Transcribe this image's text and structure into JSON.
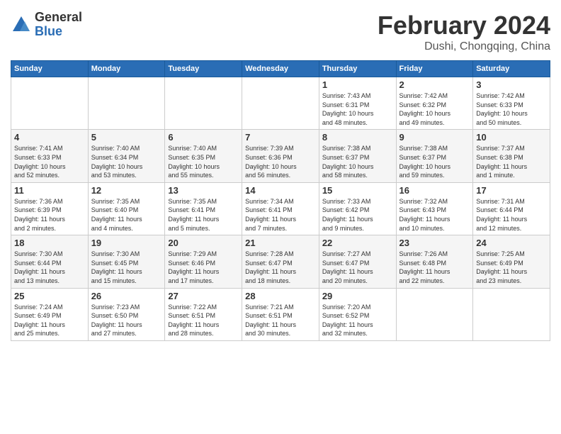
{
  "logo": {
    "general": "General",
    "blue": "Blue"
  },
  "title": "February 2024",
  "location": "Dushi, Chongqing, China",
  "headers": [
    "Sunday",
    "Monday",
    "Tuesday",
    "Wednesday",
    "Thursday",
    "Friday",
    "Saturday"
  ],
  "weeks": [
    [
      {
        "day": "",
        "info": ""
      },
      {
        "day": "",
        "info": ""
      },
      {
        "day": "",
        "info": ""
      },
      {
        "day": "",
        "info": ""
      },
      {
        "day": "1",
        "info": "Sunrise: 7:43 AM\nSunset: 6:31 PM\nDaylight: 10 hours\nand 48 minutes."
      },
      {
        "day": "2",
        "info": "Sunrise: 7:42 AM\nSunset: 6:32 PM\nDaylight: 10 hours\nand 49 minutes."
      },
      {
        "day": "3",
        "info": "Sunrise: 7:42 AM\nSunset: 6:33 PM\nDaylight: 10 hours\nand 50 minutes."
      }
    ],
    [
      {
        "day": "4",
        "info": "Sunrise: 7:41 AM\nSunset: 6:33 PM\nDaylight: 10 hours\nand 52 minutes."
      },
      {
        "day": "5",
        "info": "Sunrise: 7:40 AM\nSunset: 6:34 PM\nDaylight: 10 hours\nand 53 minutes."
      },
      {
        "day": "6",
        "info": "Sunrise: 7:40 AM\nSunset: 6:35 PM\nDaylight: 10 hours\nand 55 minutes."
      },
      {
        "day": "7",
        "info": "Sunrise: 7:39 AM\nSunset: 6:36 PM\nDaylight: 10 hours\nand 56 minutes."
      },
      {
        "day": "8",
        "info": "Sunrise: 7:38 AM\nSunset: 6:37 PM\nDaylight: 10 hours\nand 58 minutes."
      },
      {
        "day": "9",
        "info": "Sunrise: 7:38 AM\nSunset: 6:37 PM\nDaylight: 10 hours\nand 59 minutes."
      },
      {
        "day": "10",
        "info": "Sunrise: 7:37 AM\nSunset: 6:38 PM\nDaylight: 11 hours\nand 1 minute."
      }
    ],
    [
      {
        "day": "11",
        "info": "Sunrise: 7:36 AM\nSunset: 6:39 PM\nDaylight: 11 hours\nand 2 minutes."
      },
      {
        "day": "12",
        "info": "Sunrise: 7:35 AM\nSunset: 6:40 PM\nDaylight: 11 hours\nand 4 minutes."
      },
      {
        "day": "13",
        "info": "Sunrise: 7:35 AM\nSunset: 6:41 PM\nDaylight: 11 hours\nand 5 minutes."
      },
      {
        "day": "14",
        "info": "Sunrise: 7:34 AM\nSunset: 6:41 PM\nDaylight: 11 hours\nand 7 minutes."
      },
      {
        "day": "15",
        "info": "Sunrise: 7:33 AM\nSunset: 6:42 PM\nDaylight: 11 hours\nand 9 minutes."
      },
      {
        "day": "16",
        "info": "Sunrise: 7:32 AM\nSunset: 6:43 PM\nDaylight: 11 hours\nand 10 minutes."
      },
      {
        "day": "17",
        "info": "Sunrise: 7:31 AM\nSunset: 6:44 PM\nDaylight: 11 hours\nand 12 minutes."
      }
    ],
    [
      {
        "day": "18",
        "info": "Sunrise: 7:30 AM\nSunset: 6:44 PM\nDaylight: 11 hours\nand 13 minutes."
      },
      {
        "day": "19",
        "info": "Sunrise: 7:30 AM\nSunset: 6:45 PM\nDaylight: 11 hours\nand 15 minutes."
      },
      {
        "day": "20",
        "info": "Sunrise: 7:29 AM\nSunset: 6:46 PM\nDaylight: 11 hours\nand 17 minutes."
      },
      {
        "day": "21",
        "info": "Sunrise: 7:28 AM\nSunset: 6:47 PM\nDaylight: 11 hours\nand 18 minutes."
      },
      {
        "day": "22",
        "info": "Sunrise: 7:27 AM\nSunset: 6:47 PM\nDaylight: 11 hours\nand 20 minutes."
      },
      {
        "day": "23",
        "info": "Sunrise: 7:26 AM\nSunset: 6:48 PM\nDaylight: 11 hours\nand 22 minutes."
      },
      {
        "day": "24",
        "info": "Sunrise: 7:25 AM\nSunset: 6:49 PM\nDaylight: 11 hours\nand 23 minutes."
      }
    ],
    [
      {
        "day": "25",
        "info": "Sunrise: 7:24 AM\nSunset: 6:49 PM\nDaylight: 11 hours\nand 25 minutes."
      },
      {
        "day": "26",
        "info": "Sunrise: 7:23 AM\nSunset: 6:50 PM\nDaylight: 11 hours\nand 27 minutes."
      },
      {
        "day": "27",
        "info": "Sunrise: 7:22 AM\nSunset: 6:51 PM\nDaylight: 11 hours\nand 28 minutes."
      },
      {
        "day": "28",
        "info": "Sunrise: 7:21 AM\nSunset: 6:51 PM\nDaylight: 11 hours\nand 30 minutes."
      },
      {
        "day": "29",
        "info": "Sunrise: 7:20 AM\nSunset: 6:52 PM\nDaylight: 11 hours\nand 32 minutes."
      },
      {
        "day": "",
        "info": ""
      },
      {
        "day": "",
        "info": ""
      }
    ]
  ]
}
